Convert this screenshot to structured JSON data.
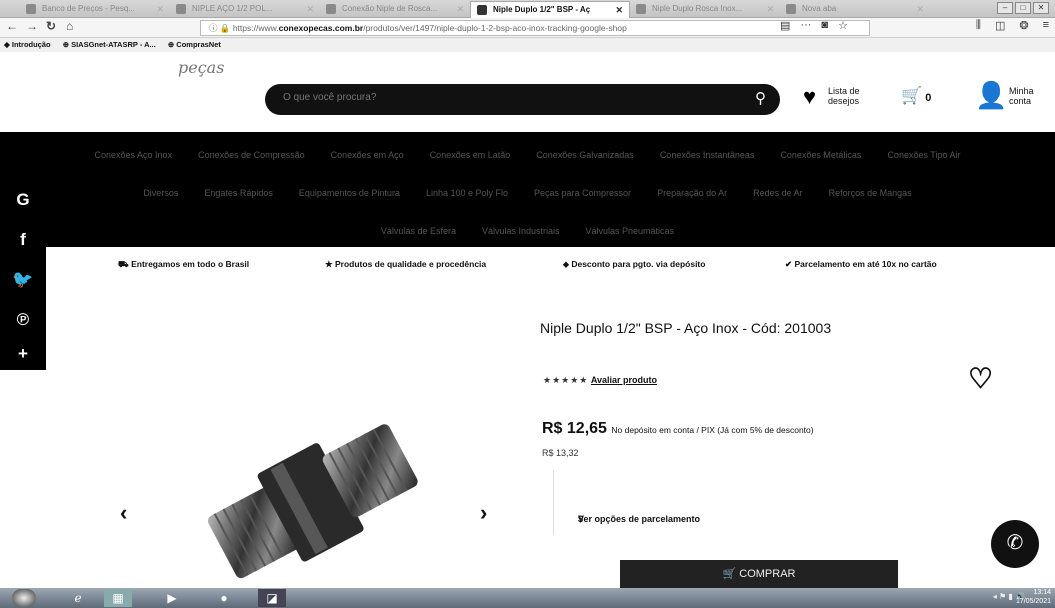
{
  "browser": {
    "tabs": [
      {
        "label": "Banco de Preços - Pesq...",
        "active": false
      },
      {
        "label": "NIPLE AÇO 1/2 POL...",
        "active": false
      },
      {
        "label": "Conexão Niple de Rosca...",
        "active": false
      },
      {
        "label": "Niple Duplo 1/2\" BSP - Aç",
        "active": true
      },
      {
        "label": "Niple Duplo Rosca Inox...",
        "active": false
      },
      {
        "label": "Nova aba",
        "active": false
      }
    ],
    "url_prefix": "https://www.",
    "url_domain": "conexopecas.com.br",
    "url_path": "/produtos/ver/1497/niple-duplo-1-2-bsp-aco-inox-tracking-google-shop",
    "bookmarks": [
      "Introdução",
      "SIASGnet-ATASRP - A...",
      "ComprasNet"
    ]
  },
  "header": {
    "logo_text": "peças",
    "search_placeholder": "O que você procura?",
    "wishlist_label": "Lista de desejos",
    "cart_count": "0",
    "account_label": "Minha conta"
  },
  "categories": {
    "row1": [
      "Conexões Aço Inox",
      "Conexões de Compressão",
      "Conexões em Aço",
      "Conexões em Latão",
      "Conexões Galvanizadas",
      "Conexões Instantâneas",
      "Conexões Metálicas",
      "Conexões Tipo Air"
    ],
    "row2": [
      "Diversos",
      "Engates Rápidos",
      "Equipamentos de Pintura",
      "Linha 100 e Poly Flo",
      "Peças para Compressor",
      "Preparação do Ar",
      "Redes de Ar",
      "Reforços de Mangas"
    ],
    "row3": [
      "Válvulas de Esfera",
      "Válvulas Industriais",
      "Válvulas Pneumáticas"
    ]
  },
  "benefits": [
    "Entregamos em todo o Brasil",
    "Produtos de qualidade e procedência",
    "Desconto para pgto. via depósito",
    "Parcelamento em até 10x no cartão"
  ],
  "product": {
    "title": "Niple Duplo 1/2\" BSP - Aço Inox - Cód: 201003",
    "stars": "★★★★★",
    "rate_link": "Avaliar produto",
    "price": "R$ 12,65",
    "price_note": "No depósito em conta / PIX (Já com 5% de desconto)",
    "old_price": "R$ 13,32",
    "installments_label": "Ver opções de parcelamento",
    "buy_label": "COMPRAR"
  },
  "taskbar": {
    "time": "13:14",
    "date": "17/05/2021"
  }
}
